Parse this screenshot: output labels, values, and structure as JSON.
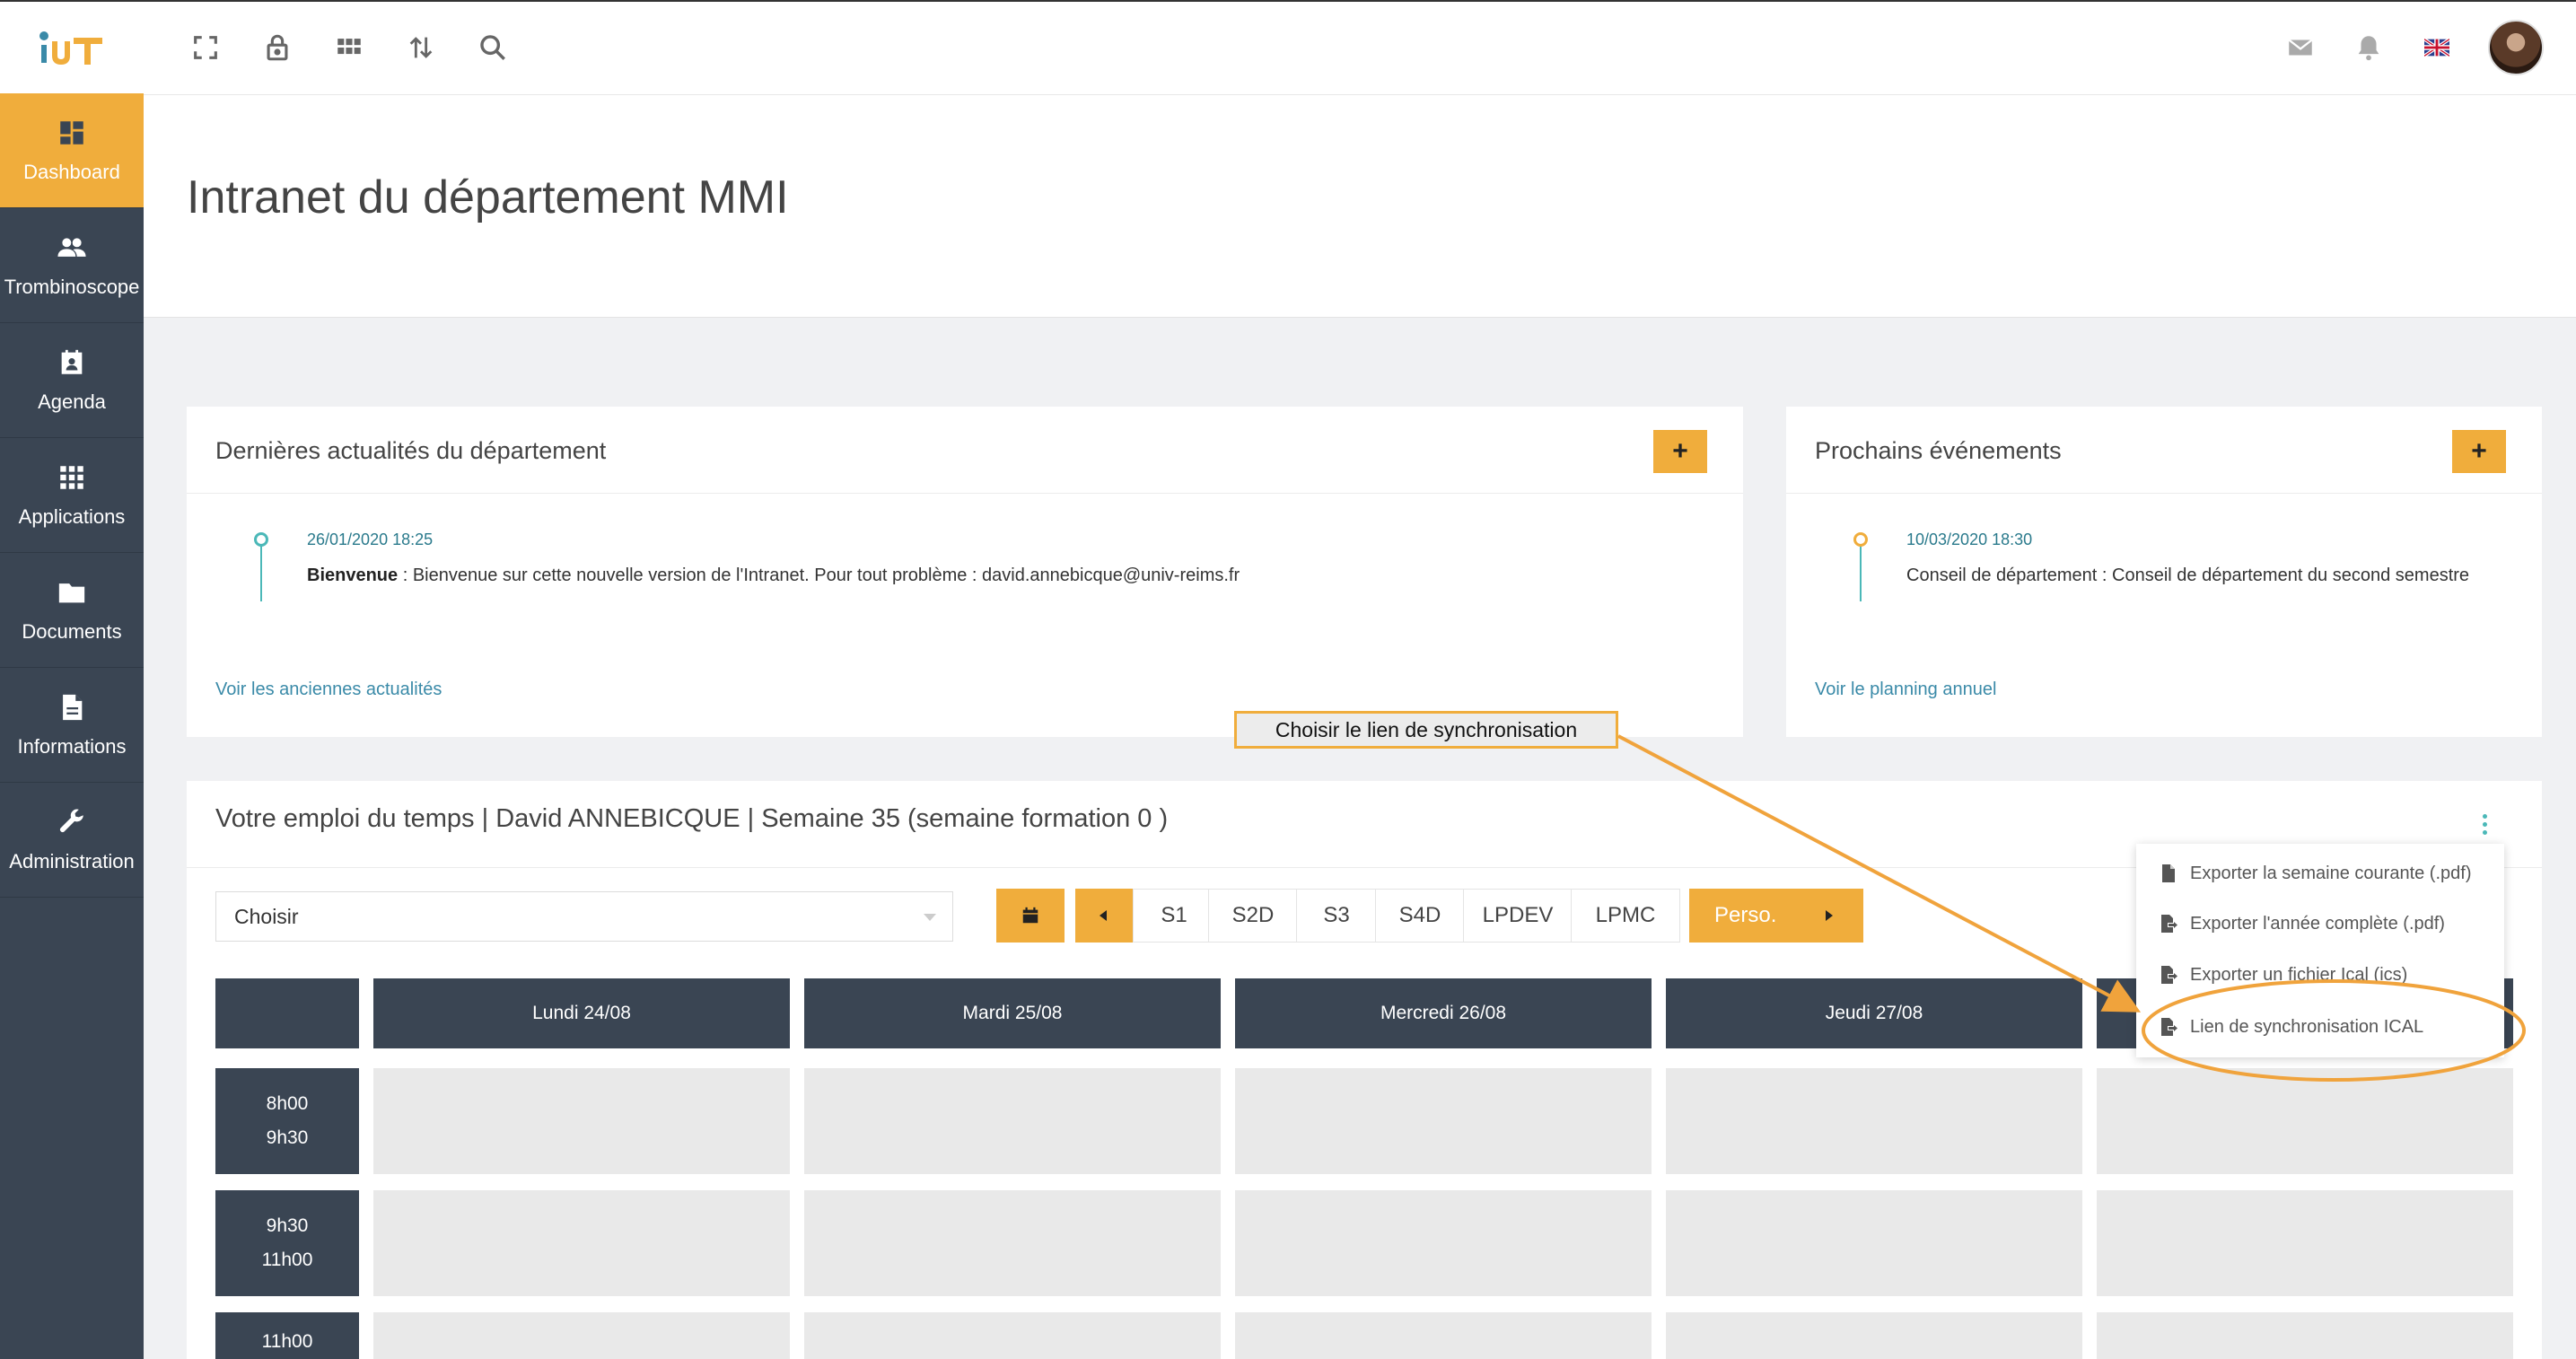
{
  "brand": {
    "logo_text": "iuT"
  },
  "page": {
    "title": "Intranet du département MMI"
  },
  "toolbar": {
    "icons": [
      "fullscreen-icon",
      "lock-icon",
      "apps-grid-icon",
      "sort-arrows-icon",
      "search-icon"
    ],
    "right_icons": [
      "mail-icon",
      "bell-icon",
      "uk-flag-icon",
      "avatar"
    ]
  },
  "sidebar": {
    "items": [
      {
        "label": "Dashboard",
        "icon": "dashboard-icon",
        "active": true
      },
      {
        "label": "Trombinoscope",
        "icon": "people-icon"
      },
      {
        "label": "Agenda",
        "icon": "agenda-icon"
      },
      {
        "label": "Applications",
        "icon": "apps-icon"
      },
      {
        "label": "Documents",
        "icon": "folder-icon"
      },
      {
        "label": "Informations",
        "icon": "document-icon"
      },
      {
        "label": "Administration",
        "icon": "wrench-icon"
      }
    ]
  },
  "news": {
    "title": "Dernières actualités du département",
    "add_label": "+",
    "item": {
      "date": "26/01/2020 18:25",
      "heading": "Bienvenue",
      "text": " : Bienvenue sur cette nouvelle version de l'Intranet. Pour tout problème : david.annebicque@univ-reims.fr"
    },
    "link": "Voir les anciennes actualités"
  },
  "events": {
    "title": "Prochains événements",
    "add_label": "+",
    "item": {
      "date": "10/03/2020 18:30",
      "text": "Conseil de département : Conseil de département du second semestre"
    },
    "link": "Voir le planning annuel"
  },
  "schedule": {
    "title": "Votre emploi du temps | David ANNEBICQUE | Semaine 35 (semaine formation 0 )",
    "select_value": "Choisir",
    "tabs": [
      "S1",
      "S2D",
      "S3",
      "S4D",
      "LPDEV",
      "LPMC"
    ],
    "perso_label": "Perso.",
    "days": [
      "Lundi 24/08",
      "Mardi 25/08",
      "Mercredi 26/08",
      "Jeudi 27/08"
    ],
    "slots": [
      {
        "start": "8h00",
        "end": "9h30"
      },
      {
        "start": "9h30",
        "end": "11h00"
      },
      {
        "start": "11h00",
        "end": ""
      }
    ]
  },
  "menu": {
    "items": [
      "Exporter la semaine courante (.pdf)",
      "Exporter l'année complète (.pdf)",
      "Exporter un fichier Ical (ics)",
      "Lien de synchronisation ICAL"
    ]
  },
  "annotation": {
    "callout": "Choisir le lien de synchronisation",
    "color": "#f0a33c"
  },
  "colors": {
    "accent": "#f0ad3c",
    "sidebar": "#3a4553",
    "teal": "#4bb8b8",
    "link": "#3a8aa8"
  }
}
